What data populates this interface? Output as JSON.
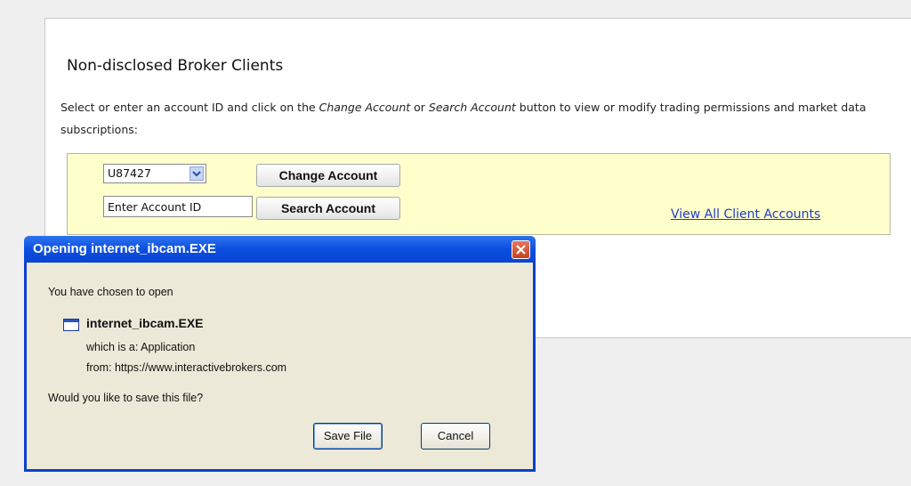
{
  "page": {
    "title": "Non-disclosed Broker Clients",
    "description_1": "Select or enter an account ID and click on the ",
    "description_em1": "Change Account",
    "description_2": " or ",
    "description_em2": "Search Account",
    "description_3": " button to view or modify trading permissions and market data subscriptions:"
  },
  "account_form": {
    "selected_account": "U87427",
    "account_input_placeholder": "Enter Account ID",
    "change_button": "Change Account",
    "search_button": "Search Account",
    "view_all_link": "View All Client Accounts"
  },
  "dialog": {
    "title": "Opening internet_ibcam.EXE",
    "chosen_text": "You have chosen to open",
    "filename": "internet_ibcam.EXE",
    "which_is": "which is a:  Application",
    "from": "from:  https://www.interactivebrokers.com",
    "question": "Would you like to save this file?",
    "save_button": "Save File",
    "cancel_button": "Cancel"
  },
  "colors": {
    "highlight_box": "#ffffcc",
    "link": "#1f3cc8",
    "titlebar": "#0c4fe0"
  },
  "icons": {
    "select_arrow": "chevron-down-icon",
    "close": "close-icon",
    "file": "file-icon"
  }
}
